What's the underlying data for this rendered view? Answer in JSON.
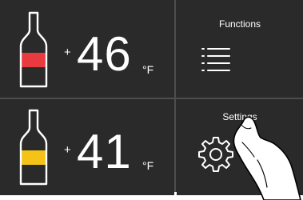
{
  "zones": [
    {
      "plus": "+",
      "temperature": "46",
      "unit": "°F",
      "bottle_color": "#e83a3f"
    },
    {
      "plus": "+",
      "temperature": "41",
      "unit": "°F",
      "bottle_color": "#f5c318"
    }
  ],
  "functions": {
    "label": "Functions",
    "icon": "menu-icon"
  },
  "settings": {
    "label": "Settings",
    "icon": "gear-icon"
  },
  "colors": {
    "background": "#2a2a2a",
    "divider": "#4d4d4d",
    "text": "#ffffff"
  }
}
